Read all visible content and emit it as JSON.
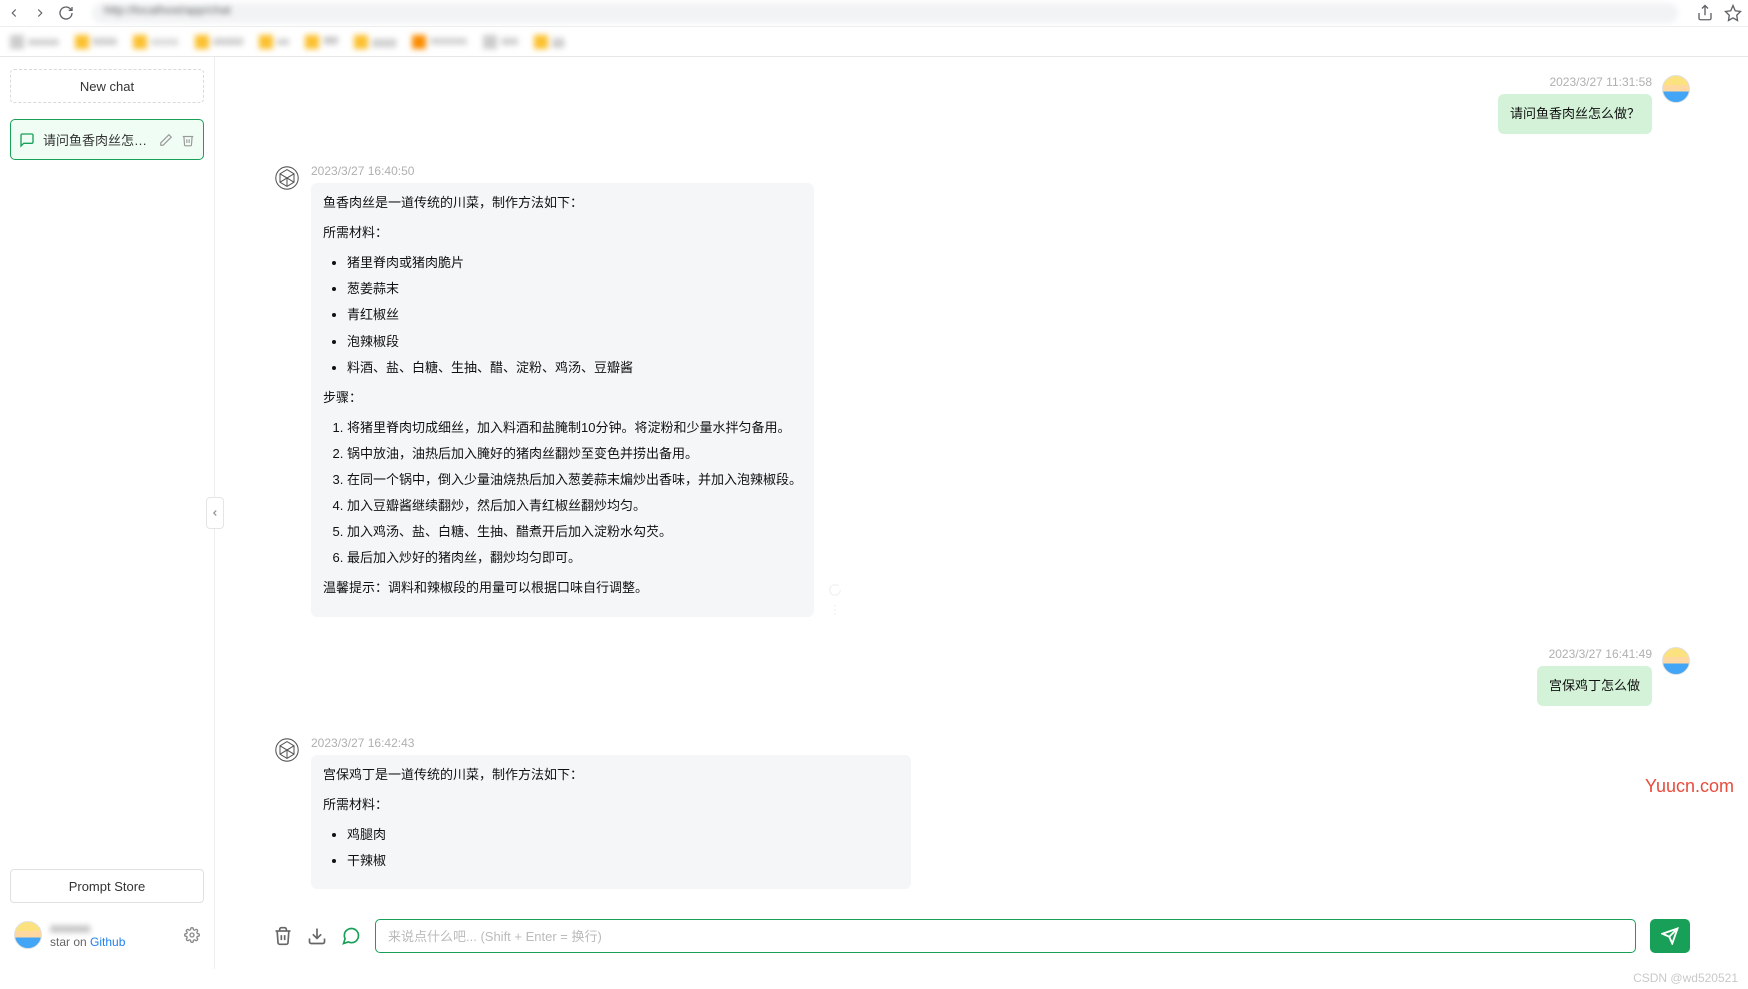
{
  "browser": {
    "back_icon": "back",
    "forward_icon": "forward",
    "reload_icon": "reload"
  },
  "sidebar": {
    "new_chat_label": "New chat",
    "items": [
      {
        "title": "请问鱼香肉丝怎么..."
      }
    ],
    "prompt_store_label": "Prompt Store",
    "github_prefix": "star on",
    "github_link": "Github"
  },
  "messages": [
    {
      "role": "user",
      "time": "2023/3/27 11:31:58",
      "text": "请问鱼香肉丝怎么做？"
    },
    {
      "role": "assistant",
      "time": "2023/3/27 16:40:50",
      "intro": "鱼香肉丝是一道传统的川菜，制作方法如下：",
      "materials_heading": "所需材料：",
      "materials": [
        "猪里脊肉或猪肉脆片",
        "葱姜蒜末",
        "青红椒丝",
        "泡辣椒段",
        "料酒、盐、白糖、生抽、醋、淀粉、鸡汤、豆瓣酱"
      ],
      "steps_heading": "步骤：",
      "steps": [
        "将猪里脊肉切成细丝，加入料酒和盐腌制10分钟。将淀粉和少量水拌匀备用。",
        "锅中放油，油热后加入腌好的猪肉丝翻炒至变色并捞出备用。",
        "在同一个锅中，倒入少量油烧热后加入葱姜蒜末煸炒出香味，并加入泡辣椒段。",
        "加入豆瓣酱继续翻炒，然后加入青红椒丝翻炒均匀。",
        "加入鸡汤、盐、白糖、生抽、醋煮开后加入淀粉水勾芡。",
        "最后加入炒好的猪肉丝，翻炒均匀即可。"
      ],
      "tip": "温馨提示：调料和辣椒段的用量可以根据口味自行调整。"
    },
    {
      "role": "user",
      "time": "2023/3/27 16:41:49",
      "text": "宫保鸡丁怎么做"
    },
    {
      "role": "assistant",
      "time": "2023/3/27 16:42:43",
      "intro": "宫保鸡丁是一道传统的川菜，制作方法如下：",
      "materials_heading": "所需材料：",
      "materials": [
        "鸡腿肉",
        "干辣椒"
      ]
    }
  ],
  "input": {
    "placeholder": "来说点什么吧... (Shift + Enter = 换行)"
  },
  "watermarks": {
    "yuucn": "Yuucn.com",
    "csdn": "CSDN @wd520521"
  }
}
